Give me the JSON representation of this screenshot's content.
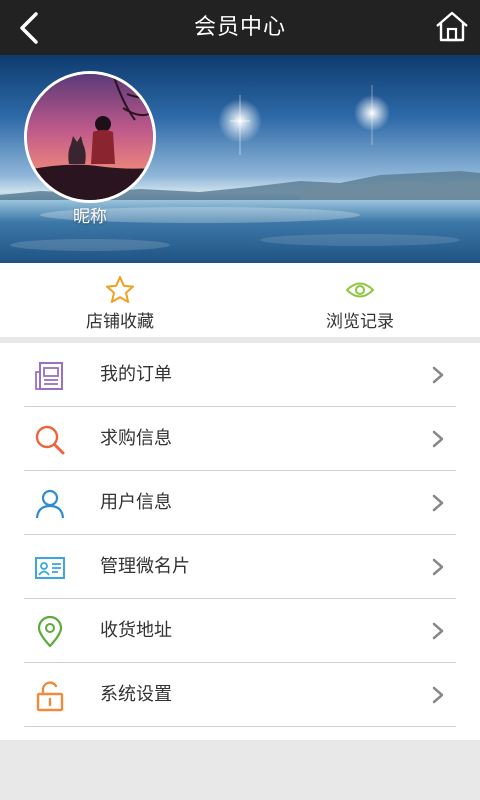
{
  "header": {
    "title": "会员中心",
    "back_icon": "chevron-left-icon",
    "home_icon": "house-icon"
  },
  "profile": {
    "nickname": "昵称"
  },
  "quick_actions": [
    {
      "label": "店铺收藏",
      "icon": "star-icon",
      "color": "#f0a020"
    },
    {
      "label": "浏览记录",
      "icon": "eye-icon",
      "color": "#8dc63f"
    }
  ],
  "menu": [
    {
      "label": "我的订单",
      "icon": "order-list-icon",
      "color": "#9b6fc2"
    },
    {
      "label": "求购信息",
      "icon": "search-icon",
      "color": "#f0643c"
    },
    {
      "label": "用户信息",
      "icon": "user-icon",
      "color": "#2f8ad8"
    },
    {
      "label": "管理微名片",
      "icon": "id-card-icon",
      "color": "#3aa7e0"
    },
    {
      "label": "收货地址",
      "icon": "location-pin-icon",
      "color": "#5aaa3a"
    },
    {
      "label": "系统设置",
      "icon": "unlock-icon",
      "color": "#f08a3c"
    }
  ],
  "colors": {
    "header_bg": "#222222",
    "divider": "#cfcfcf",
    "chevron": "#888888"
  }
}
